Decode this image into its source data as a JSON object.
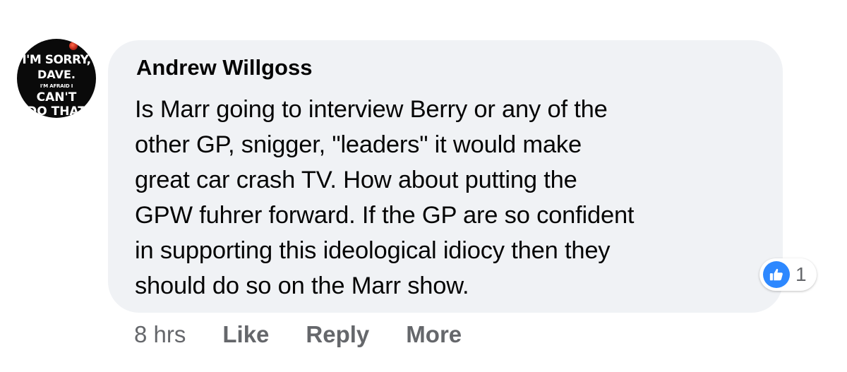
{
  "avatar": {
    "line1": "I'M SORRY,",
    "line2": "DAVE.",
    "line3": "I'M AFRAID I",
    "line4": "CAN'T",
    "line5": "DO THAT"
  },
  "comment": {
    "author": "Andrew Willgoss",
    "text_lines": [
      "Is Marr going to interview Berry or any of the",
      "other GP, snigger, \"leaders\" it would make",
      "great car crash TV. How about putting the",
      "GPW fuhrer forward. If the GP are so confident",
      "in supporting this ideological idiocy then they",
      "should do so on the Marr show."
    ]
  },
  "reaction": {
    "icon": "thumbs-up-icon",
    "count": "1",
    "color": "#2d88ff"
  },
  "actions": {
    "time": "8 hrs",
    "like": "Like",
    "reply": "Reply",
    "more": "More"
  },
  "colors": {
    "bubble": "#f0f2f5",
    "text": "#050505",
    "secondary": "#65676b"
  }
}
